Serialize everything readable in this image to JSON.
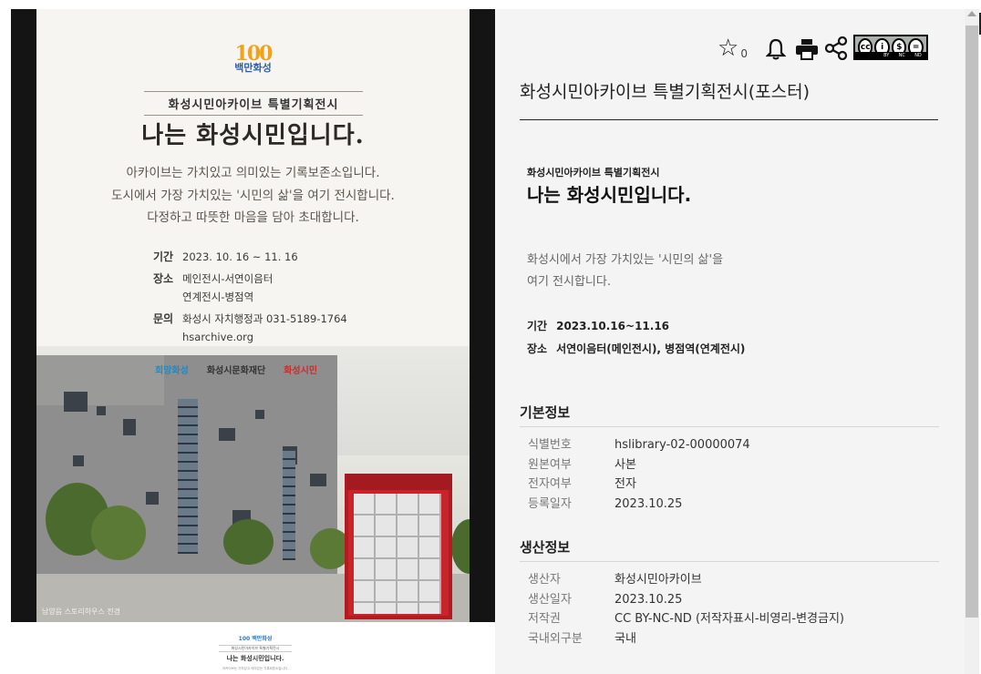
{
  "poster": {
    "logo_number": "100",
    "logo_text": "백만화성",
    "subtitle": "화성시민아카이브 특별기획전시",
    "title": "나는 화성시민입니다.",
    "body": [
      "아카이브는 가치있고 의미있는 기록보존소입니다.",
      "도시에서 가장 가치있는 '시민의 삶'을 여기 전시합니다.",
      "다정하고 따뜻한 마음을 담아 초대합니다."
    ],
    "info": [
      {
        "key": "기간",
        "value": "2023. 10. 16 ~ 11. 16"
      },
      {
        "key": "장소",
        "value": "메인전시-서연이음터\n연계전시-병점역"
      },
      {
        "key": "문의",
        "value": "화성시 자치행정과 031-5189-1764\nhsarchive.org"
      }
    ],
    "sponsors": [
      "희망화성",
      "화성시문화재단",
      "화성시민"
    ],
    "photo_caption": "남양읍 스토리하우스 전경"
  },
  "thumbnail": {
    "logo": "100 백만화성",
    "subtitle": "화성시민아카이브 특별기획전시",
    "title": "나는 화성시민입니다.",
    "line": "아카이브는 가치있고 의미있는 기록보존소입니다."
  },
  "toolbar": {
    "star_count": "0",
    "icons": [
      "star-icon",
      "bell-icon",
      "print-icon",
      "share-icon",
      "cc-license-badge"
    ],
    "cc_labels": [
      "BY",
      "NC",
      "ND"
    ]
  },
  "record": {
    "title": "화성시민아카이브 특별기획전시(포스터)",
    "summary_subtitle": "화성시민아카이브 특별기획전시",
    "summary_title": "나는 화성시민입니다.",
    "summary_desc": [
      "화성시에서 가장 가치있는 '시민의 삶'을",
      "여기 전시합니다."
    ],
    "facts": [
      {
        "key": "기간",
        "value": "2023.10.16~11.16"
      },
      {
        "key": "장소",
        "value": "서연이음터(메인전시), 병점역(연계전시)"
      }
    ]
  },
  "basic_info": {
    "heading": "기본정보",
    "rows": [
      {
        "key": "식별번호",
        "value": "hslibrary-02-00000074"
      },
      {
        "key": "원본여부",
        "value": "사본"
      },
      {
        "key": "전자여부",
        "value": "전자"
      },
      {
        "key": "등록일자",
        "value": "2023.10.25"
      }
    ]
  },
  "production_info": {
    "heading": "생산정보",
    "rows": [
      {
        "key": "생산자",
        "value": "화성시민아카이브"
      },
      {
        "key": "생산일자",
        "value": "2023.10.25"
      },
      {
        "key": "저작권",
        "value": "CC BY-NC-ND (저작자표시-비영리-변경금지)"
      },
      {
        "key": "국내외구분",
        "value": "국내"
      }
    ]
  }
}
